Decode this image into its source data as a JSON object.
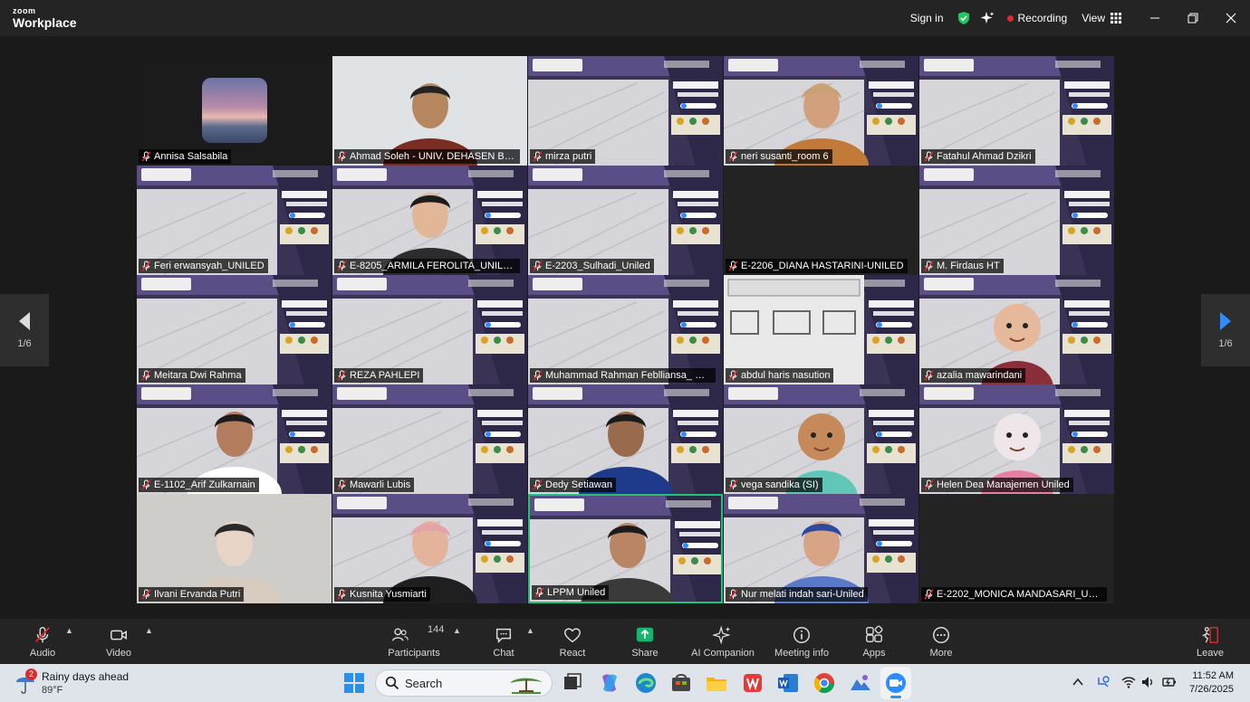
{
  "app": {
    "logo_top": "zoom",
    "logo_bottom": "Workplace",
    "sign_in": "Sign in",
    "recording": "Recording",
    "view": "View"
  },
  "pagination": {
    "left": "1/6",
    "right": "1/6"
  },
  "participants": [
    {
      "name": "Annisa Salsabila",
      "kind": "avatar"
    },
    {
      "name": "Ahmad Soleh - UNIV. DEHASEN BEN...",
      "kind": "person-light"
    },
    {
      "name": "mirza putri",
      "kind": "slide"
    },
    {
      "name": "neri susanti_room 6",
      "kind": "slide-person"
    },
    {
      "name": "Fatahul Ahmad Dzikri",
      "kind": "slide"
    },
    {
      "name": "Feri erwansyah_UNILED",
      "kind": "slide"
    },
    {
      "name": "E-8205_ARMILA FEROLITA_UNILED",
      "kind": "slide-person"
    },
    {
      "name": "E-2203_Sulhadi_Uniled",
      "kind": "slide"
    },
    {
      "name": "E-2206_DIANA HASTARINI-UNILED",
      "kind": "dark"
    },
    {
      "name": "M. Firdaus HT",
      "kind": "slide"
    },
    {
      "name": "Meitara Dwi Rahma",
      "kind": "slide"
    },
    {
      "name": "REZA PAHLEPI",
      "kind": "slide"
    },
    {
      "name": "Muhammad Rahman Feblliansa_ Univ...",
      "kind": "slide"
    },
    {
      "name": "abdul haris nasution",
      "kind": "slide-building"
    },
    {
      "name": "azalia mawarindani",
      "kind": "slide-avatar"
    },
    {
      "name": "E-1102_Arif Zulkarnain",
      "kind": "slide-person"
    },
    {
      "name": "Mawarli Lubis",
      "kind": "slide"
    },
    {
      "name": "Dedy Setiawan",
      "kind": "slide-person"
    },
    {
      "name": "vega sandika (SI)",
      "kind": "slide-avatar"
    },
    {
      "name": "Helen Dea Manajemen Uniled",
      "kind": "slide-avatar"
    },
    {
      "name": "Ilvani Ervanda Putri",
      "kind": "person-light"
    },
    {
      "name": "Kusnita Yusmiarti",
      "kind": "slide-person"
    },
    {
      "name": "LPPM Uniled",
      "kind": "slide-person",
      "active": true
    },
    {
      "name": "Nur melati indah sari-Uniled",
      "kind": "slide-person"
    },
    {
      "name": "E-2202_MONICA MANDASARI_UNIL...",
      "kind": "dark"
    }
  ],
  "toolbar": {
    "audio": "Audio",
    "video": "Video",
    "participants": "Participants",
    "participant_count": "144",
    "chat": "Chat",
    "react": "React",
    "share": "Share",
    "ai_companion": "AI Companion",
    "meeting_info": "Meeting info",
    "apps": "Apps",
    "more": "More",
    "leave": "Leave"
  },
  "taskbar": {
    "weather_badge": "2",
    "weather_title": "Rainy days ahead",
    "weather_temp": "89°F",
    "search": "Search",
    "time": "11:52 AM",
    "date": "7/26/2025"
  },
  "colors": {
    "share_green": "#12b76a",
    "active_border": "#22c27a",
    "record_red": "#e02828"
  }
}
